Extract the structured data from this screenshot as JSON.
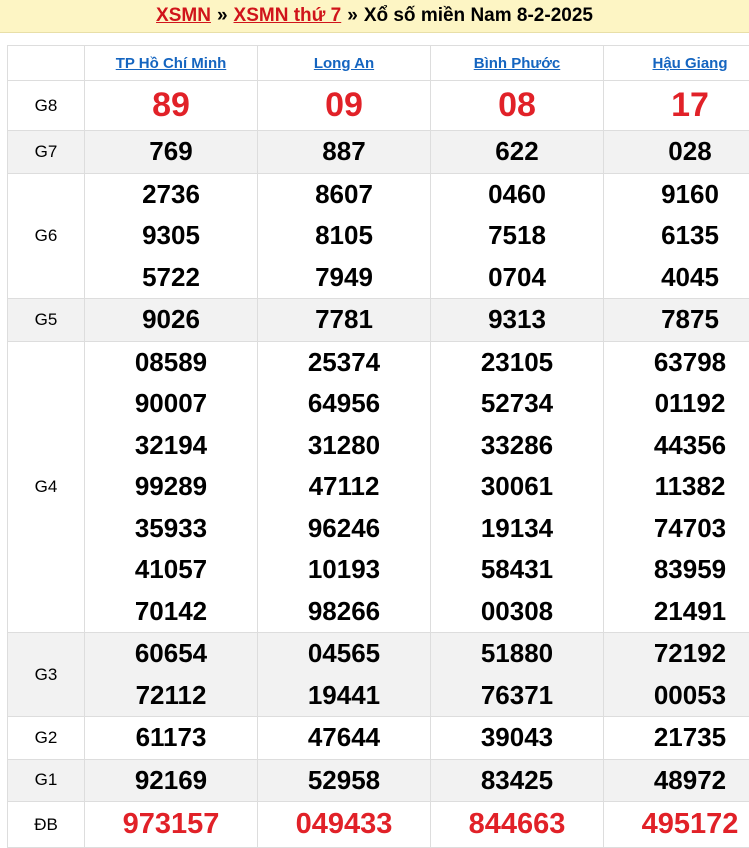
{
  "header": {
    "link1": "XSMN",
    "sep1": "»",
    "link2": "XSMN thứ 7",
    "sep2": "»",
    "title": "Xổ số miền Nam 8-2-2025"
  },
  "provinces": [
    "TP Hồ Chí Minh",
    "Long An",
    "Bình Phước",
    "Hậu Giang"
  ],
  "prizes": [
    {
      "label": "G8",
      "values": [
        [
          "89"
        ],
        [
          "09"
        ],
        [
          "08"
        ],
        [
          "17"
        ]
      ]
    },
    {
      "label": "G7",
      "values": [
        [
          "769"
        ],
        [
          "887"
        ],
        [
          "622"
        ],
        [
          "028"
        ]
      ]
    },
    {
      "label": "G6",
      "values": [
        [
          "2736",
          "9305",
          "5722"
        ],
        [
          "8607",
          "8105",
          "7949"
        ],
        [
          "0460",
          "7518",
          "0704"
        ],
        [
          "9160",
          "6135",
          "4045"
        ]
      ]
    },
    {
      "label": "G5",
      "values": [
        [
          "9026"
        ],
        [
          "7781"
        ],
        [
          "9313"
        ],
        [
          "7875"
        ]
      ]
    },
    {
      "label": "G4",
      "values": [
        [
          "08589",
          "90007",
          "32194",
          "99289",
          "35933",
          "41057",
          "70142"
        ],
        [
          "25374",
          "64956",
          "31280",
          "47112",
          "96246",
          "10193",
          "98266"
        ],
        [
          "23105",
          "52734",
          "33286",
          "30061",
          "19134",
          "58431",
          "00308"
        ],
        [
          "63798",
          "01192",
          "44356",
          "11382",
          "74703",
          "83959",
          "21491"
        ]
      ]
    },
    {
      "label": "G3",
      "values": [
        [
          "60654",
          "72112"
        ],
        [
          "04565",
          "19441"
        ],
        [
          "51880",
          "76371"
        ],
        [
          "72192",
          "00053"
        ]
      ]
    },
    {
      "label": "G2",
      "values": [
        [
          "61173"
        ],
        [
          "47644"
        ],
        [
          "39043"
        ],
        [
          "21735"
        ]
      ]
    },
    {
      "label": "G1",
      "values": [
        [
          "92169"
        ],
        [
          "52958"
        ],
        [
          "83425"
        ],
        [
          "48972"
        ]
      ]
    },
    {
      "label": "ĐB",
      "values": [
        [
          "973157"
        ],
        [
          "049433"
        ],
        [
          "844663"
        ],
        [
          "495172"
        ]
      ]
    }
  ],
  "colors": {
    "accent_red": "#e12128",
    "link_blue": "#1565c0",
    "header_bg": "#fdf5c4"
  }
}
